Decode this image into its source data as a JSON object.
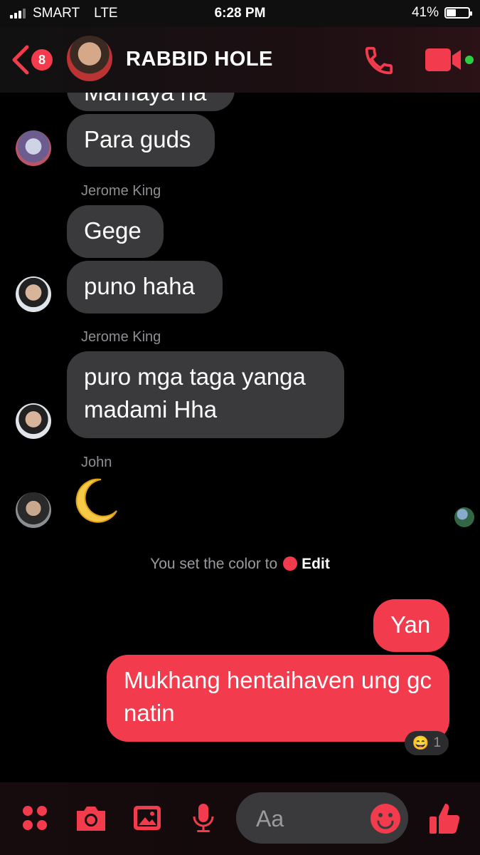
{
  "status_bar": {
    "carrier": "SMART",
    "network": "LTE",
    "time": "6:28 PM",
    "battery": "41%",
    "battery_fraction": 0.41
  },
  "header": {
    "back_badge": "8",
    "title": "RABBID HOLE"
  },
  "messages": [
    {
      "id": "m0",
      "text": "Mamaya na",
      "mine": false
    },
    {
      "id": "m1",
      "text": "Para guds",
      "mine": false
    },
    {
      "id": "s1",
      "sender": "Jerome King"
    },
    {
      "id": "m2",
      "text": "Gege",
      "mine": false
    },
    {
      "id": "m3",
      "text": "puno haha",
      "mine": false
    },
    {
      "id": "s2",
      "sender": "Jerome King"
    },
    {
      "id": "m4",
      "text": "puro mga taga yanga madami Hha",
      "mine": false
    },
    {
      "id": "s3",
      "sender": "John"
    },
    {
      "id": "m5",
      "text": "🌙",
      "mine": false
    },
    {
      "id": "m6",
      "text": "Yan",
      "mine": true
    },
    {
      "id": "m7",
      "text": "Mukhang hentaihaven ung gc natin",
      "mine": true
    }
  ],
  "system_notice": {
    "text": "You set the color to",
    "action": "Edit"
  },
  "reaction": {
    "emoji": "😄",
    "count": "1"
  },
  "composer": {
    "placeholder": "Aa"
  },
  "colors": {
    "accent": "#f23b4d",
    "bubble_other": "#3a3a3c",
    "background": "#000000",
    "online": "#2ecc40"
  },
  "icons": [
    "back-chevron-icon",
    "phone-icon",
    "video-camera-icon",
    "apps-grid-icon",
    "camera-icon",
    "image-icon",
    "microphone-icon",
    "emoji-icon",
    "thumbs-up-icon"
  ]
}
